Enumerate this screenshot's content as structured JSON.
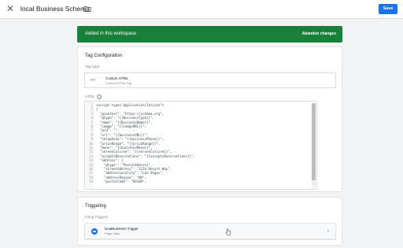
{
  "header": {
    "close_icon": "close-icon",
    "title": "local Business Schema",
    "folder_icon": "folder-icon",
    "save_label": "Save"
  },
  "banner": {
    "text": "Added in this workspace",
    "action": "Abandon changes",
    "color": "#188038"
  },
  "tag_config": {
    "title": "Tag Configuration",
    "tag_type_label": "Tag Type",
    "tag_type_name": "Custom HTML",
    "tag_type_sub": "Custom HTML Tag",
    "tag_type_icon": "code-icon",
    "html_label": "HTML",
    "code_lines": [
      {
        "n": "1",
        "text": "<script type=\"application/ld+json\">"
      },
      {
        "n": "2",
        "text": "{"
      },
      {
        "n": "3",
        "text": "  \"@context\": \"https://schema.org\","
      },
      {
        "n": "4",
        "text": "  \"@type\": \"{{BusinessType}}\","
      },
      {
        "n": "5",
        "text": "  \"name\": \"{{BusinessName}}\","
      },
      {
        "n": "6",
        "text": "  \"image\": \"{{imageURL}}\","
      },
      {
        "n": "7",
        "text": "  \"@id\": \"\","
      },
      {
        "n": "8",
        "text": "  \"url\": \"{{businessURL}}\","
      },
      {
        "n": "9",
        "text": "  \"telephone\": \"{{businessPhone}}\","
      },
      {
        "n": "10",
        "text": "  \"priceRange\": \"{{priceRange}}\","
      },
      {
        "n": "11",
        "text": "  \"menu\": \"{{businessMenu}}\","
      },
      {
        "n": "12",
        "text": "  \"servesCuisine\": \"{{servesCuisine}}\","
      },
      {
        "n": "13",
        "text": "  \"acceptsReservations\": \"{{acceptsReservations}}\","
      },
      {
        "n": "14",
        "text": "  \"address\": {"
      },
      {
        "n": "15",
        "text": "    \"@type\": \"PostalAddress\","
      },
      {
        "n": "16",
        "text": "    \"streetAddress\": \"1234 Resort Way\","
      },
      {
        "n": "17",
        "text": "    \"addressLocality\": \"Las Vegas\","
      },
      {
        "n": "18",
        "text": "    \"addressRegion\": \"NV\","
      },
      {
        "n": "19",
        "text": "    \"postalCode\": \"89109\","
      }
    ]
  },
  "triggering": {
    "title": "Triggering",
    "firing_label": "Firing Triggers",
    "trigger_name": "localBusiness Trigger",
    "trigger_sub": "Page View",
    "trigger_icon": "pageview-icon",
    "chevron_icon": "chevron-right-icon"
  },
  "colors": {
    "accent": "#1a73e8",
    "background": "#f1f3f4"
  }
}
